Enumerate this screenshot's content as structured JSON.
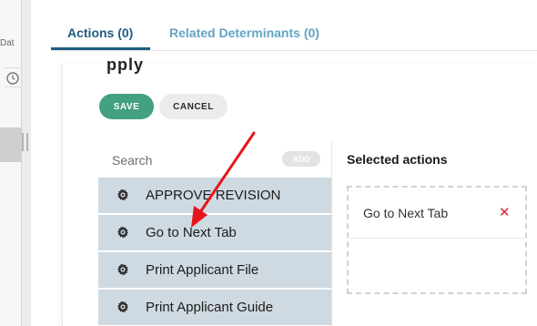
{
  "left_panel": {
    "partial_label": "Dat",
    "clock_icon": "clock-icon"
  },
  "tabs": [
    {
      "label": "Actions (0)",
      "active": true
    },
    {
      "label": "Related Determinants (0)",
      "active": false
    }
  ],
  "section": {
    "clipped_title": "pply"
  },
  "buttons": {
    "save": "SAVE",
    "cancel": "CANCEL"
  },
  "available": {
    "search_placeholder": "Search",
    "add_label": "ADD",
    "items": [
      {
        "label": "APPROVE REVISION",
        "icon": "gear-icon"
      },
      {
        "label": "Go to Next Tab",
        "icon": "gear-icon"
      },
      {
        "label": "Print Applicant File",
        "icon": "gear-icon"
      },
      {
        "label": "Print Applicant Guide",
        "icon": "gear-icon"
      }
    ]
  },
  "selected": {
    "title": "Selected actions",
    "items": [
      {
        "label": "Go to Next Tab",
        "remove_icon": "close-icon"
      }
    ]
  },
  "colors": {
    "tab_active": "#205d82",
    "tab_inactive": "#63a4c3",
    "save_button": "#43a083",
    "list_item_bg": "#cfd9e1",
    "remove": "#e0242c",
    "annotation_arrow": "#e8141c"
  }
}
